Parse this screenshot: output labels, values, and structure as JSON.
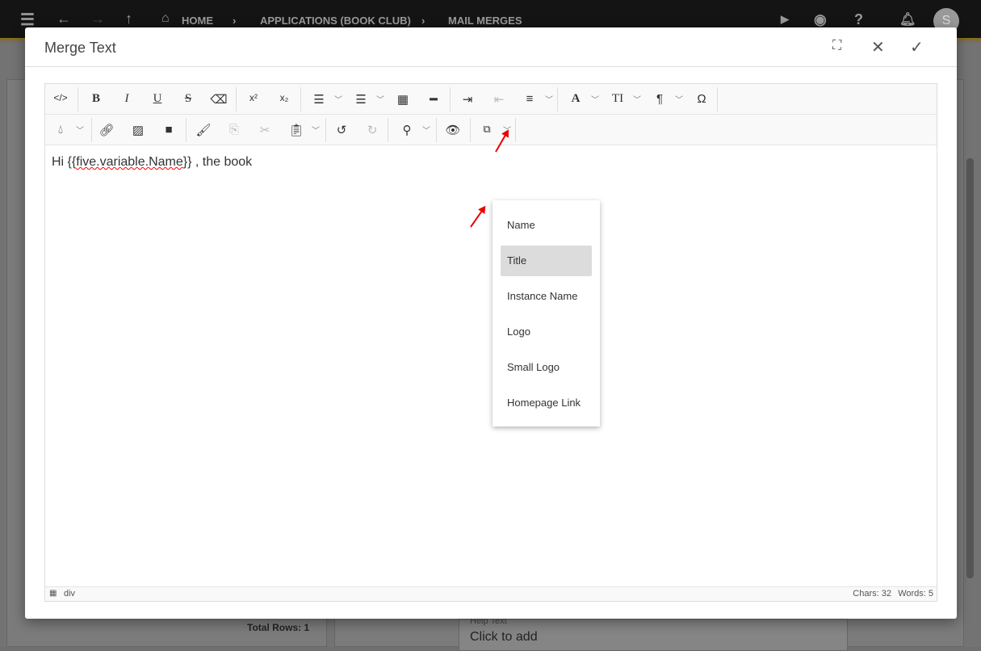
{
  "topbar": {
    "breadcrumbs": [
      "HOME",
      "APPLICATIONS (BOOK CLUB)",
      "MAIL MERGES"
    ],
    "avatar": "S"
  },
  "background": {
    "total_rows": "Total Rows: 1",
    "help_label": "Help Text",
    "help_value": "Click to add"
  },
  "modal": {
    "title": "Merge Text"
  },
  "editor": {
    "content_prefix": "Hi {{",
    "content_var": "five.variable.Name",
    "content_suffix": "}} , the book",
    "status_path": "div",
    "chars": "Chars: 32",
    "words": "Words: 5"
  },
  "merge_dropdown": {
    "items": [
      "Name",
      "Title",
      "Instance Name",
      "Logo",
      "Small Logo",
      "Homepage Link"
    ],
    "selected": "Title"
  },
  "colors": {
    "annotation_arrow": "#e00000",
    "topbar_accent": "#8a6d1c"
  }
}
